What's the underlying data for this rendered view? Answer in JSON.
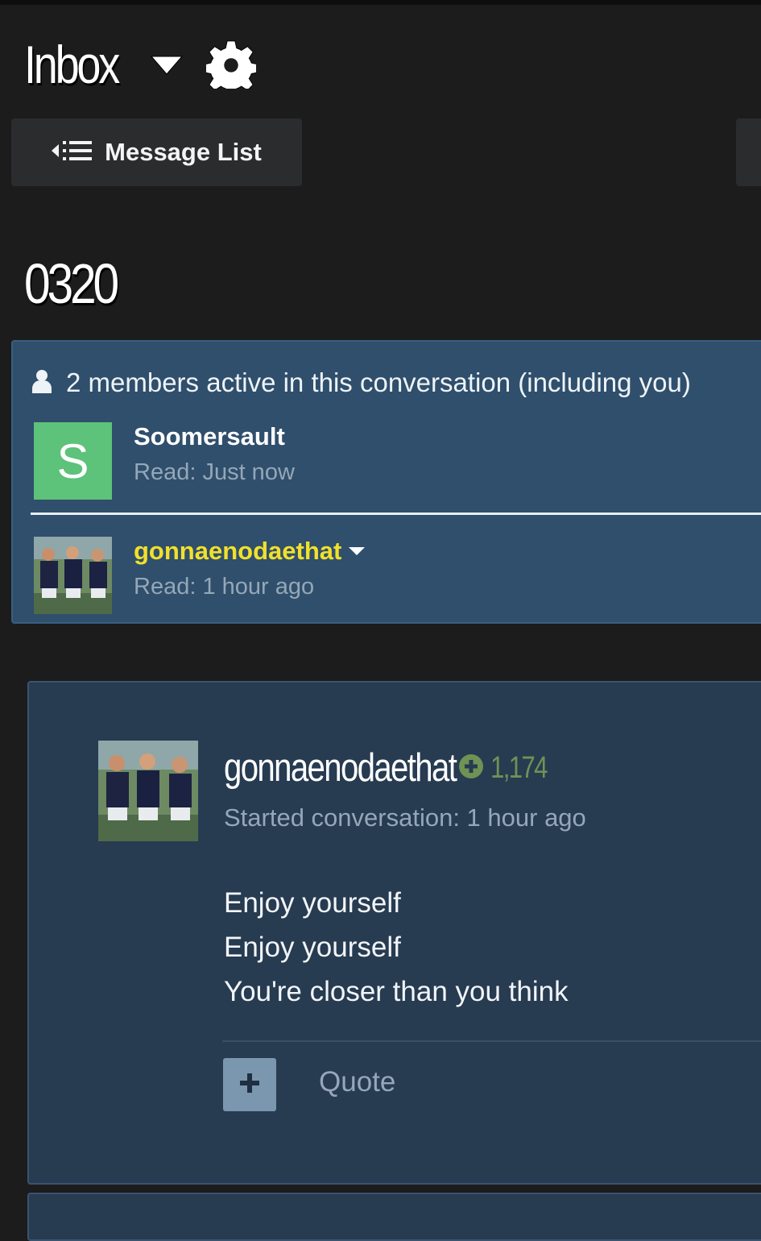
{
  "header": {
    "title": "Inbox",
    "caret_icon": "caret-down-icon",
    "settings_icon": "gear-icon"
  },
  "nav": {
    "message_list_label": "Message List",
    "message_list_icon": "list-back-icon"
  },
  "conversation": {
    "title": "0320"
  },
  "members": {
    "header_icon": "user-icon",
    "header_text": "2 members active in this conversation (including you)",
    "items": [
      {
        "name": "Soomersault",
        "read": "Read: Just now",
        "avatar_letter": "S",
        "avatar_color": "#5dc27a",
        "name_color": "#ffffff"
      },
      {
        "name": "gonnaenodaethat",
        "read": "Read: 1 hour ago",
        "name_color": "#f2e02a",
        "has_menu": true
      }
    ]
  },
  "post": {
    "author": "gonnaenodaethat",
    "reputation": "1,174",
    "reputation_icon": "plus-circle-icon",
    "reputation_color": "#6f9255",
    "started": "Started conversation: 1 hour ago",
    "body_lines": [
      "Enjoy yourself",
      "Enjoy yourself",
      "You're closer than you think"
    ],
    "add_icon": "plus-icon",
    "quote_label": "Quote"
  },
  "colors": {
    "background": "#1c1c1d",
    "panel": "#2f4f6c",
    "post_panel": "#273b51",
    "muted_text": "#95a7b8"
  }
}
